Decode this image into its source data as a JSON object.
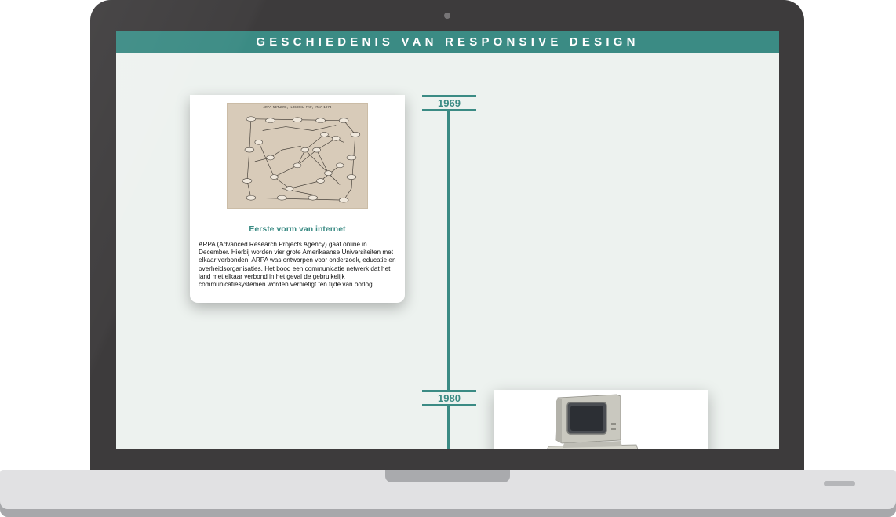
{
  "page": {
    "title": "GESCHIEDENIS VAN RESPONSIVE DESIGN"
  },
  "timeline": {
    "entries": [
      {
        "year": "1969",
        "title": "Eerste vorm van internet",
        "text": "ARPA (Advanced Research Projects Agency) gaat online in December. Hierbij worden vier grote Amerikaanse Universiteiten met elkaar verbonden. ARPA was ontworpen voor onderzoek, educatie en overheidsorganisaties. Het bood een communicatie netwerk dat het land met elkaar verbond in het geval de gebruikelijk communicatiesystemen worden vernietigt ten tijde van oorlog.",
        "image_caption": "ARPA NETWORK, LOGICAL MAP, MAY 1973",
        "image_icon": "arpanet-map-image"
      },
      {
        "year": "1980",
        "image_icon": "personal-computer-image"
      }
    ]
  },
  "colors": {
    "accent": "#3b8b84",
    "page_background": "#edf2ef",
    "laptop_body": "#3d3b3c",
    "laptop_base": "#e1e1e3"
  }
}
